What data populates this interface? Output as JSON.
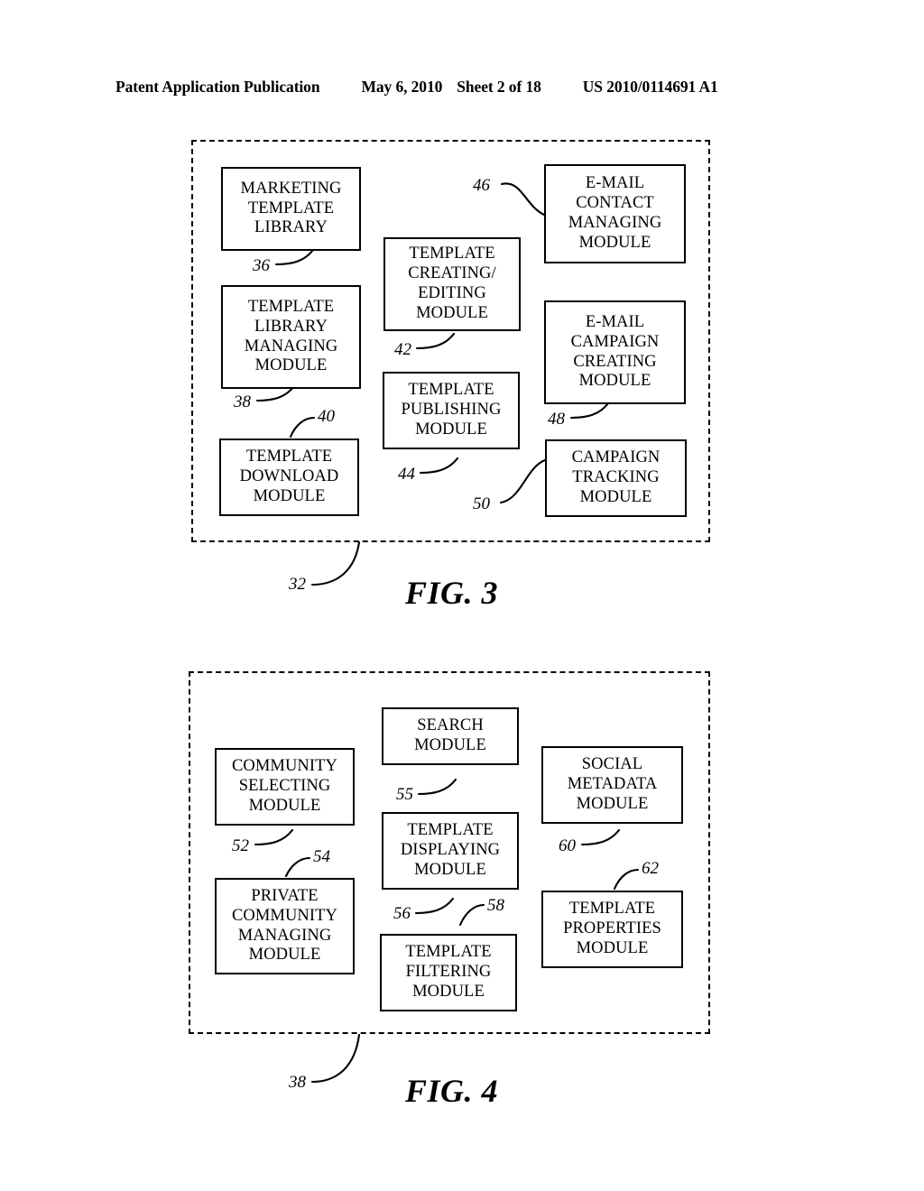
{
  "header": {
    "publication": "Patent Application Publication",
    "date": "May 6, 2010",
    "sheet": "Sheet 2 of 18",
    "document_number": "US 2010/0114691 A1"
  },
  "figures": [
    {
      "caption": "FIG. 3",
      "container_ref": "32",
      "modules": [
        {
          "ref": "36",
          "lines": [
            "MARKETING",
            "TEMPLATE",
            "LIBRARY"
          ]
        },
        {
          "ref": "38",
          "lines": [
            "TEMPLATE",
            "LIBRARY",
            "MANAGING",
            "MODULE"
          ]
        },
        {
          "ref": "40",
          "lines": [
            "TEMPLATE",
            "DOWNLOAD",
            "MODULE"
          ]
        },
        {
          "ref": "42",
          "lines": [
            "TEMPLATE",
            "CREATING/",
            "EDITING",
            "MODULE"
          ]
        },
        {
          "ref": "44",
          "lines": [
            "TEMPLATE",
            "PUBLISHING",
            "MODULE"
          ]
        },
        {
          "ref": "46",
          "lines": [
            "E-MAIL",
            "CONTACT",
            "MANAGING",
            "MODULE"
          ]
        },
        {
          "ref": "48",
          "lines": [
            "E-MAIL",
            "CAMPAIGN",
            "CREATING",
            "MODULE"
          ]
        },
        {
          "ref": "50",
          "lines": [
            "CAMPAIGN",
            "TRACKING",
            "MODULE"
          ]
        }
      ]
    },
    {
      "caption": "FIG. 4",
      "container_ref": "38",
      "modules": [
        {
          "ref": "52",
          "lines": [
            "COMMUNITY",
            "SELECTING",
            "MODULE"
          ]
        },
        {
          "ref": "54",
          "lines": [
            "PRIVATE",
            "COMMUNITY",
            "MANAGING",
            "MODULE"
          ]
        },
        {
          "ref": "55",
          "lines": [
            "SEARCH",
            "MODULE"
          ]
        },
        {
          "ref": "56",
          "lines": [
            "TEMPLATE",
            "DISPLAYING",
            "MODULE"
          ]
        },
        {
          "ref": "58",
          "lines": [
            "TEMPLATE",
            "FILTERING",
            "MODULE"
          ]
        },
        {
          "ref": "60",
          "lines": [
            "SOCIAL",
            "METADATA",
            "MODULE"
          ]
        },
        {
          "ref": "62",
          "lines": [
            "TEMPLATE",
            "PROPERTIES",
            "MODULE"
          ]
        }
      ]
    }
  ]
}
